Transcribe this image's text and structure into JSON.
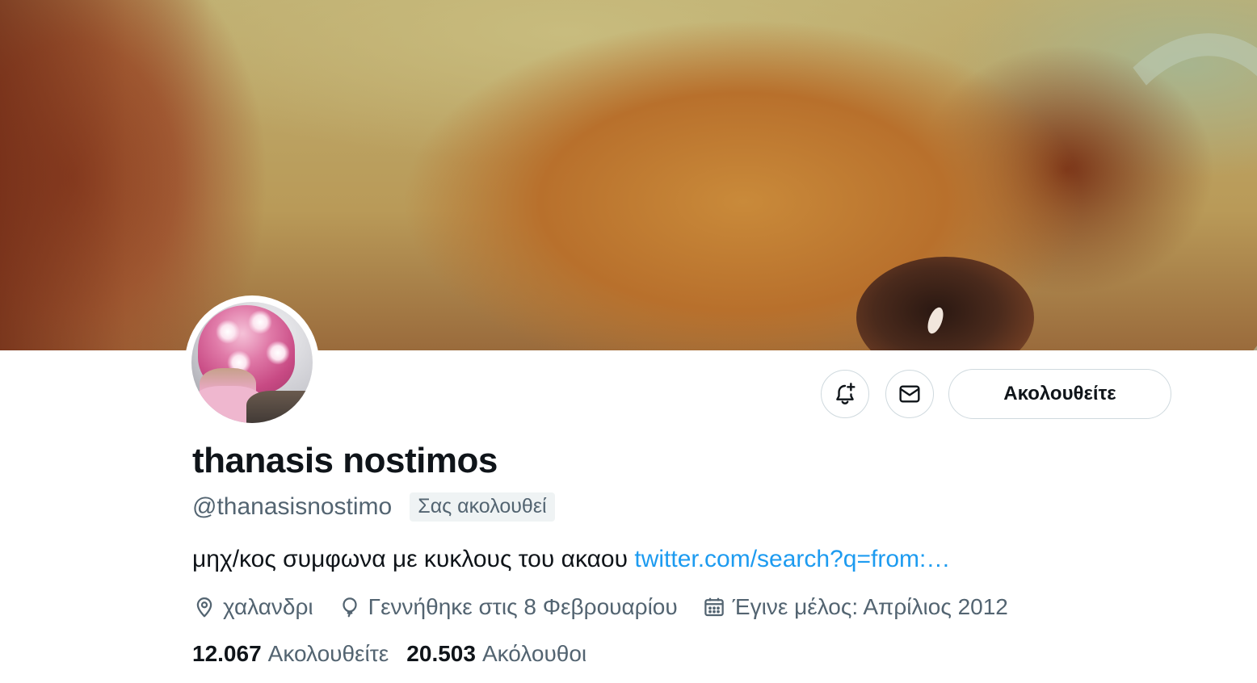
{
  "profile": {
    "display_name": "thanasis nostimos",
    "handle": "@thanasisnostimo",
    "follows_you_badge": "Σας ακολουθεί",
    "bio_text": "μηχ/κος συμφωνα με κυκλους του ακαου ",
    "bio_link": "twitter.com/search?q=from:…",
    "location": "χαλανδρι",
    "birthday": "Γεννήθηκε στις 8 Φεβρουαρίου",
    "joined": "Έγινε μέλος: Απρίλιος 2012"
  },
  "stats": {
    "following_count": "12.067",
    "following_label": "Ακολουθείτε",
    "followers_count": "20.503",
    "followers_label": "Ακόλουθοι"
  },
  "actions": {
    "follow_state_label": "Ακολουθείτε",
    "notify_icon": "bell-plus-icon",
    "message_icon": "envelope-icon"
  },
  "colors": {
    "text_primary": "#0f1419",
    "text_secondary": "#536471",
    "link": "#1d9bf0",
    "border": "#cfd9de",
    "badge_bg": "#eff3f4"
  }
}
